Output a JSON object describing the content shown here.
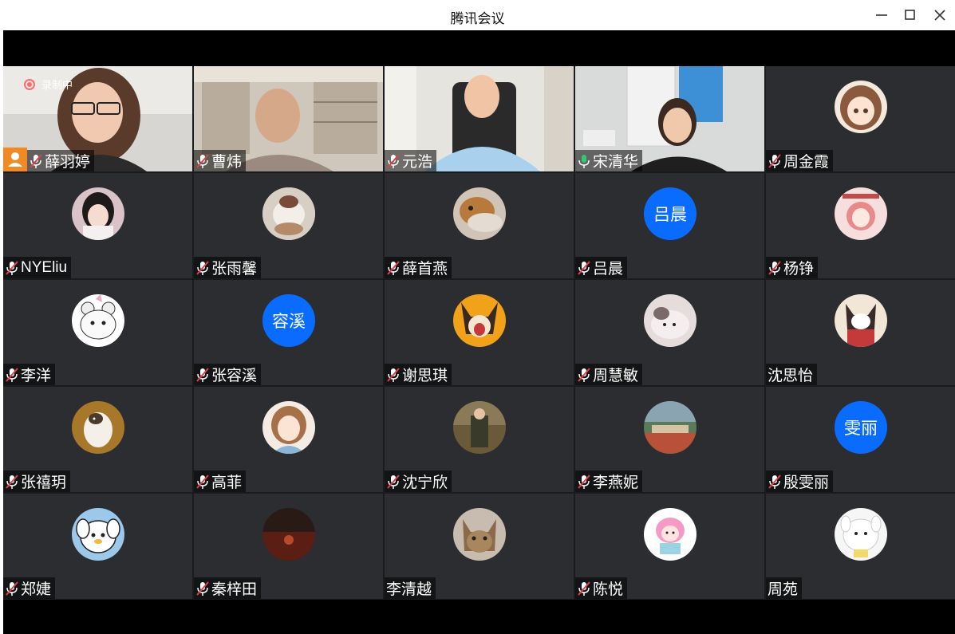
{
  "window": {
    "title": "腾讯会议"
  },
  "recording": {
    "label": "录制中"
  },
  "participants": [
    {
      "name": "薛羽婷"
    },
    {
      "name": "曹炜"
    },
    {
      "name": "元浩"
    },
    {
      "name": "宋清华"
    },
    {
      "name": "周金霞"
    },
    {
      "name": "NYEliu"
    },
    {
      "name": "张雨馨"
    },
    {
      "name": "薛首燕"
    },
    {
      "name": "吕晨",
      "avatar_text": "吕晨"
    },
    {
      "name": "杨铮"
    },
    {
      "name": "李洋"
    },
    {
      "name": "张容溪",
      "avatar_text": "容溪"
    },
    {
      "name": "谢思琪"
    },
    {
      "name": "周慧敏"
    },
    {
      "name": "沈思怡"
    },
    {
      "name": "张禧玥"
    },
    {
      "name": "高菲"
    },
    {
      "name": "沈宁欣"
    },
    {
      "name": "李燕妮"
    },
    {
      "name": "殷雯丽",
      "avatar_text": "雯丽"
    },
    {
      "name": "郑婕"
    },
    {
      "name": "秦梓田"
    },
    {
      "name": "李清越"
    },
    {
      "name": "陈悦"
    },
    {
      "name": "周苑"
    }
  ],
  "colors": {
    "accent": "#0a6cff",
    "active_border": "#2ecc71",
    "muted_icon": "#e0404a",
    "host_badge": "#f08a24"
  }
}
